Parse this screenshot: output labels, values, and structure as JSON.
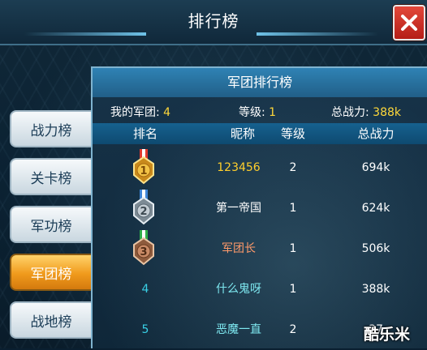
{
  "header": {
    "title": "排行榜"
  },
  "tabs": [
    {
      "label": "战力榜",
      "active": false
    },
    {
      "label": "关卡榜",
      "active": false
    },
    {
      "label": "军功榜",
      "active": false
    },
    {
      "label": "军团榜",
      "active": true
    },
    {
      "label": "战地榜",
      "active": false
    }
  ],
  "panel": {
    "title": "军团排行榜",
    "summary": {
      "my_legion_label": "我的军团:",
      "my_legion_value": "4",
      "level_label": "等级:",
      "level_value": "1",
      "power_label": "总战力:",
      "power_value": "388k"
    },
    "columns": [
      "排名",
      "昵称",
      "等级",
      "总战力"
    ],
    "rows": [
      {
        "rank": "1",
        "medal": "gold-medal-icon",
        "name": "123456",
        "level": "2",
        "power": "694k"
      },
      {
        "rank": "2",
        "medal": "silver-medal-icon",
        "name": "第一帝国",
        "level": "1",
        "power": "624k"
      },
      {
        "rank": "3",
        "medal": "bronze-medal-icon",
        "name": "军团长",
        "level": "1",
        "power": "506k"
      },
      {
        "rank": "4",
        "medal": "",
        "name": "什么鬼呀",
        "level": "1",
        "power": "388k"
      },
      {
        "rank": "5",
        "medal": "",
        "name": "恶魔一直",
        "level": "2",
        "power": "37"
      }
    ]
  },
  "watermark": {
    "text": "酷乐米"
  },
  "colors": {
    "accent_gold": "#ffd83a",
    "tab_active": "#f09a1c",
    "close_red": "#d2352a",
    "rank_teal": "#39d0e6"
  }
}
